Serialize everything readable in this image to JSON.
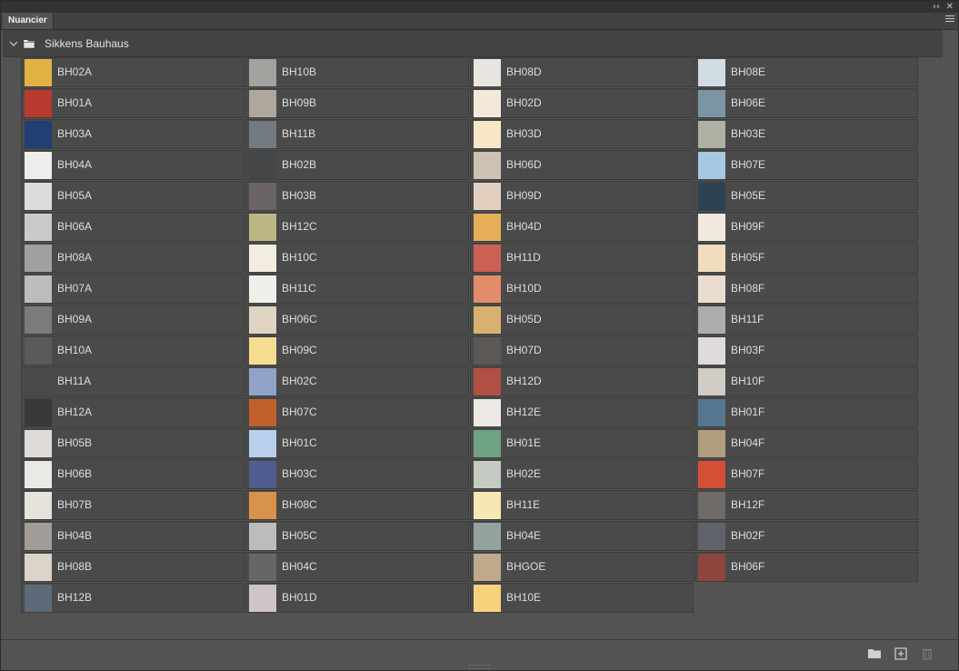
{
  "panel": {
    "tab_label": "Nuancier",
    "collapse_glyph": "‹‹",
    "close_glyph": "✕",
    "menu_icon": "hamburger-menu-icon"
  },
  "group": {
    "title": "Sikkens Bauhaus",
    "expanded": true
  },
  "columns": [
    [
      {
        "name": "BH02A",
        "color": "#e2b243"
      },
      {
        "name": "BH01A",
        "color": "#b93a2f"
      },
      {
        "name": "BH03A",
        "color": "#213f72"
      },
      {
        "name": "BH04A",
        "color": "#ededec"
      },
      {
        "name": "BH05A",
        "color": "#dcdcdb"
      },
      {
        "name": "BH06A",
        "color": "#cacaca"
      },
      {
        "name": "BH08A",
        "color": "#a0a0a0"
      },
      {
        "name": "BH07A",
        "color": "#bcbcbc"
      },
      {
        "name": "BH09A",
        "color": "#7b7b7b"
      },
      {
        "name": "BH10A",
        "color": "#5a5a5a"
      },
      {
        "name": "BH11A",
        "color": "#4a4a4a"
      },
      {
        "name": "BH12A",
        "color": "#393939"
      },
      {
        "name": "BH05B",
        "color": "#e0dcd9"
      },
      {
        "name": "BH06B",
        "color": "#ebe9e5"
      },
      {
        "name": "BH07B",
        "color": "#e6e3da"
      },
      {
        "name": "BH04B",
        "color": "#a29d99"
      },
      {
        "name": "BH08B",
        "color": "#dad4ca"
      },
      {
        "name": "BH12B",
        "color": "#5c6b77"
      }
    ],
    [
      {
        "name": "BH10B",
        "color": "#a2a39f"
      },
      {
        "name": "BH09B",
        "color": "#ada79d"
      },
      {
        "name": "BH11B",
        "color": "#737b80"
      },
      {
        "name": "BH02B",
        "color": "#444648"
      },
      {
        "name": "BH03B",
        "color": "#6a6564"
      },
      {
        "name": "BH12C",
        "color": "#bab783"
      },
      {
        "name": "BH10C",
        "color": "#f3eddf"
      },
      {
        "name": "BH11C",
        "color": "#f0f0ea"
      },
      {
        "name": "BH06C",
        "color": "#dfd4c4"
      },
      {
        "name": "BH09C",
        "color": "#f6dc93"
      },
      {
        "name": "BH02C",
        "color": "#8ea3c7"
      },
      {
        "name": "BH07C",
        "color": "#c0602c"
      },
      {
        "name": "BH01C",
        "color": "#b9cfee"
      },
      {
        "name": "BH03C",
        "color": "#4f5d91"
      },
      {
        "name": "BH08C",
        "color": "#d99249"
      },
      {
        "name": "BH05C",
        "color": "#bdbcba"
      },
      {
        "name": "BH04C",
        "color": "#646668"
      },
      {
        "name": "BH01D",
        "color": "#cfc4c6"
      }
    ],
    [
      {
        "name": "BH08D",
        "color": "#e9e5e1"
      },
      {
        "name": "BH02D",
        "color": "#f3e9d9"
      },
      {
        "name": "BH03D",
        "color": "#f7e6c5"
      },
      {
        "name": "BH06D",
        "color": "#cdc1b3"
      },
      {
        "name": "BH09D",
        "color": "#e4d0c1"
      },
      {
        "name": "BH04D",
        "color": "#e6ae59"
      },
      {
        "name": "BH11D",
        "color": "#cc6055"
      },
      {
        "name": "BH10D",
        "color": "#e48b69"
      },
      {
        "name": "BH05D",
        "color": "#d6b16f"
      },
      {
        "name": "BH07D",
        "color": "#5d5856"
      },
      {
        "name": "BH12D",
        "color": "#b14f44"
      },
      {
        "name": "BH12E",
        "color": "#edeae5"
      },
      {
        "name": "BH01E",
        "color": "#70a382"
      },
      {
        "name": "BH02E",
        "color": "#c5cbc3"
      },
      {
        "name": "BH11E",
        "color": "#f7e8b3"
      },
      {
        "name": "BH04E",
        "color": "#94a39e"
      },
      {
        "name": "BHGOE",
        "color": "#c0a88a"
      },
      {
        "name": "BH10E",
        "color": "#f7d27c"
      }
    ],
    [
      {
        "name": "BH08E",
        "color": "#d1dde1"
      },
      {
        "name": "BH06E",
        "color": "#7a96a4"
      },
      {
        "name": "BH03E",
        "color": "#aeb1a4"
      },
      {
        "name": "BH07E",
        "color": "#a5c9e3"
      },
      {
        "name": "BH05E",
        "color": "#2e4150"
      },
      {
        "name": "BH09F",
        "color": "#f1e9de"
      },
      {
        "name": "BH05F",
        "color": "#f1dcc0"
      },
      {
        "name": "BH08F",
        "color": "#ecdccd"
      },
      {
        "name": "BH11F",
        "color": "#adadad"
      },
      {
        "name": "BH03F",
        "color": "#e2dbdb"
      },
      {
        "name": "BH10F",
        "color": "#d1ccc4"
      },
      {
        "name": "BH01F",
        "color": "#577690"
      },
      {
        "name": "BH04F",
        "color": "#b39d80"
      },
      {
        "name": "BH07F",
        "color": "#d34f36"
      },
      {
        "name": "BH12F",
        "color": "#6f6b67"
      },
      {
        "name": "BH02F",
        "color": "#60636a"
      },
      {
        "name": "BH06F",
        "color": "#8c463d"
      }
    ]
  ],
  "bottom_icons": [
    "new-group-folder-icon",
    "new-swatch-icon",
    "trash-icon"
  ]
}
